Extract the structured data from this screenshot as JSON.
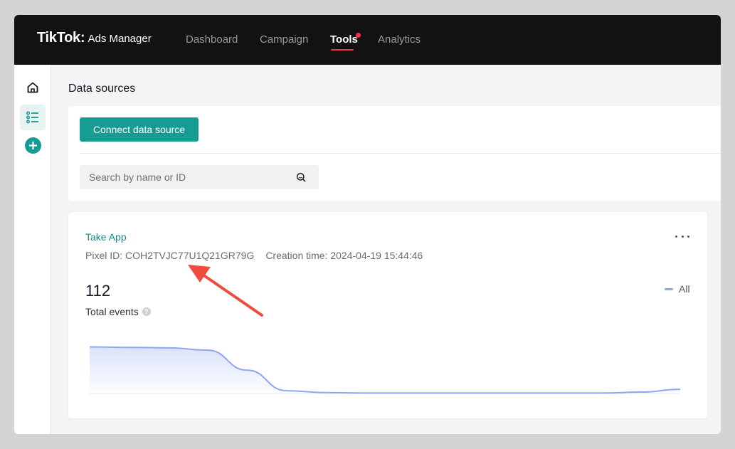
{
  "app": {
    "logo_main": "TikTok",
    "logo_colon": ":",
    "logo_sub": "Ads Manager"
  },
  "nav": {
    "items": [
      {
        "label": "Dashboard",
        "active": false
      },
      {
        "label": "Campaign",
        "active": false
      },
      {
        "label": "Tools",
        "active": true
      },
      {
        "label": "Analytics",
        "active": false
      }
    ]
  },
  "sidebar": {
    "items": [
      {
        "icon": "home-icon",
        "active": false
      },
      {
        "icon": "list-icon",
        "active": true
      },
      {
        "icon": "add-circle-icon",
        "active": false
      }
    ]
  },
  "page": {
    "title": "Data sources",
    "connect_button": "Connect data source",
    "search_placeholder": "Search by name or ID"
  },
  "source_card": {
    "name": "Take App",
    "pixel_id": "Pixel ID: COH2TVJC77U1Q21GR79G",
    "creation_time": "Creation time: 2024-04-19 15:44:46",
    "total_value": "112",
    "total_label": "Total events",
    "legend_label": "All"
  },
  "colors": {
    "accent": "#179c94",
    "link": "#178a84",
    "brand_red": "#fe2c55",
    "chart_line": "#8fa6f3",
    "annotation_arrow": "#ef4b3f"
  },
  "chart_data": {
    "type": "area",
    "title": "",
    "xlabel": "",
    "ylabel": "",
    "series": [
      {
        "name": "All",
        "values": [
          1.0,
          0.99,
          0.98,
          0.93,
          0.5,
          0.06,
          0.02,
          0.01,
          0.01,
          0.01,
          0.01,
          0.01,
          0.01,
          0.01,
          0.03,
          0.09
        ]
      }
    ],
    "ylim": [
      0,
      1.1
    ],
    "grid": false,
    "legend": "top-right"
  }
}
